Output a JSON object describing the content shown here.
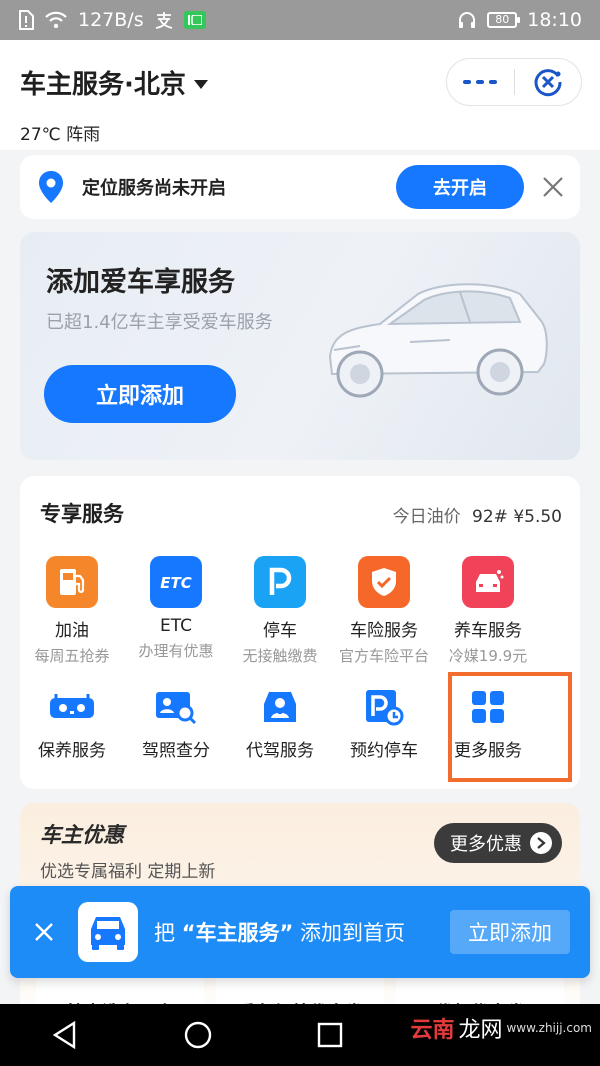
{
  "status_bar": {
    "speed": "127B/s",
    "battery": "80",
    "time": "18:10"
  },
  "header": {
    "title": "车主服务·北京",
    "weather": "27℃ 阵雨"
  },
  "location_banner": {
    "text": "定位服务尚未开启",
    "button": "去开启"
  },
  "car_banner": {
    "title": "添加爱车享服务",
    "subtitle": "已超1.4亿车主享受爱车服务",
    "button": "立即添加"
  },
  "services": {
    "title": "专享服务",
    "oil_label": "今日油价",
    "oil_grade": "92#",
    "oil_price": "¥5.50",
    "row1": [
      {
        "name": "加油",
        "desc": "每周五抢券",
        "color": "#f5872a",
        "icon": "fuel-icon"
      },
      {
        "name": "ETC",
        "desc": "办理有优惠",
        "color": "#1677ff",
        "icon": "etc-icon"
      },
      {
        "name": "停车",
        "desc": "无接触缴费",
        "color": "#1aa3f5",
        "icon": "parking-icon"
      },
      {
        "name": "车险服务",
        "desc": "官方车险平台",
        "color": "#f5682a",
        "icon": "insurance-icon"
      },
      {
        "name": "养车服务",
        "desc": "冷媒19.9元",
        "color": "#f0435a",
        "icon": "car-wash-icon"
      }
    ],
    "row2": [
      {
        "name": "保养服务",
        "icon": "maintenance-icon"
      },
      {
        "name": "驾照查分",
        "icon": "license-icon"
      },
      {
        "name": "代驾服务",
        "icon": "driver-icon"
      },
      {
        "name": "预约停车",
        "icon": "reserve-parking-icon"
      },
      {
        "name": "更多服务",
        "icon": "grid-icon"
      }
    ]
  },
  "promo": {
    "title": "车主优惠",
    "subtitle": "优选专属福利 定期上新",
    "more": "更多优惠",
    "coupons": [
      "特惠洗车一次",
      "爱车保养代金券",
      "代驾优惠券"
    ]
  },
  "toast": {
    "prefix": "把",
    "app_name": "“车主服务”",
    "suffix": "添加到首页",
    "button": "立即添加"
  },
  "watermark": {
    "brand": "云南",
    "brand2": "龙网",
    "url": "www.zhijj.com"
  },
  "colors": {
    "accent": "#1677ff",
    "highlight": "#f26c2d"
  }
}
